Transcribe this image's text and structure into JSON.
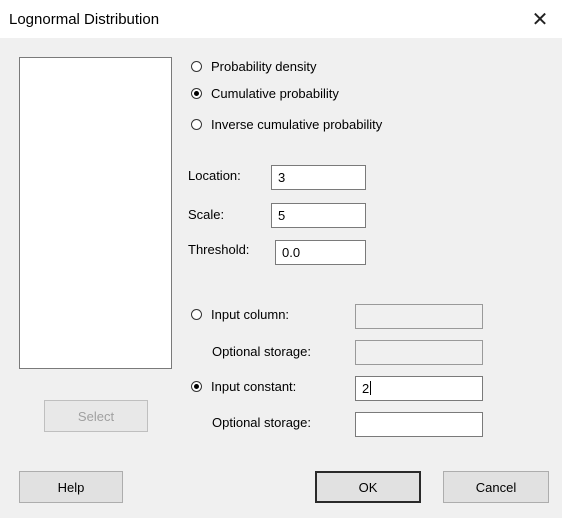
{
  "window": {
    "title": "Lognormal Distribution"
  },
  "distribution_options": [
    {
      "label": "Probability density",
      "checked": false
    },
    {
      "label": "Cumulative probability",
      "checked": true
    },
    {
      "label": "Inverse cumulative probability",
      "checked": false
    }
  ],
  "params": {
    "location_label": "Location:",
    "location_value": "3",
    "scale_label": "Scale:",
    "scale_value": "5",
    "threshold_label": "Threshold:",
    "threshold_value": "0.0"
  },
  "input": {
    "column_label": "Input column:",
    "column_value": "",
    "column_storage_label": "Optional storage:",
    "column_storage_value": "",
    "constant_label": "Input constant:",
    "constant_value": "2",
    "constant_storage_label": "Optional storage:",
    "constant_storage_value": "",
    "selected": "constant"
  },
  "buttons": {
    "select": "Select",
    "help": "Help",
    "ok": "OK",
    "cancel": "Cancel"
  }
}
